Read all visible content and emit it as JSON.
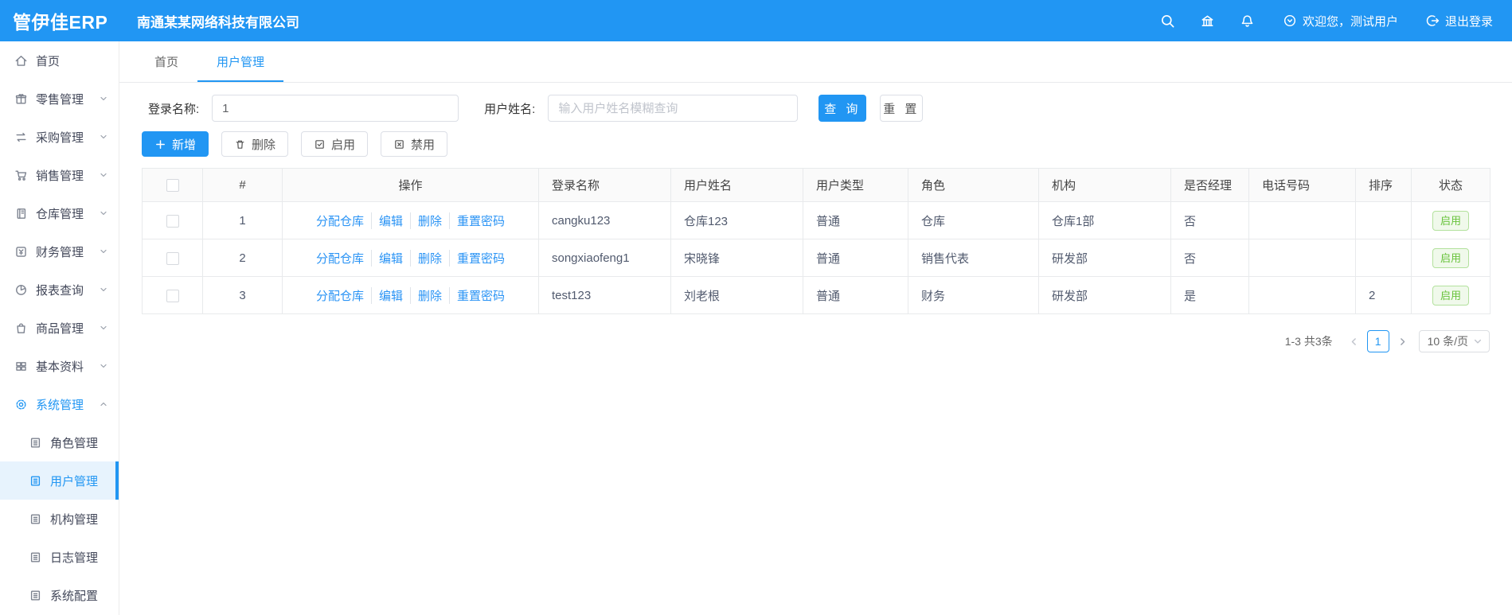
{
  "header": {
    "logo": "管伊佳ERP",
    "company": "南通某某网络科技有限公司",
    "welcome": "欢迎您，测试用户",
    "logout": "退出登录"
  },
  "sidebar": {
    "items": [
      {
        "label": "首页",
        "icon": "home-icon"
      },
      {
        "label": "零售管理",
        "icon": "retail-icon"
      },
      {
        "label": "采购管理",
        "icon": "purchase-icon"
      },
      {
        "label": "销售管理",
        "icon": "sales-cart-icon"
      },
      {
        "label": "仓库管理",
        "icon": "warehouse-icon"
      },
      {
        "label": "财务管理",
        "icon": "finance-icon"
      },
      {
        "label": "报表查询",
        "icon": "report-pie-icon"
      },
      {
        "label": "商品管理",
        "icon": "goods-bag-icon"
      },
      {
        "label": "基本资料",
        "icon": "basedata-grid-icon"
      },
      {
        "label": "系统管理",
        "icon": "system-gear-icon",
        "expanded": true
      }
    ],
    "submenu": [
      {
        "label": "角色管理",
        "active": false
      },
      {
        "label": "用户管理",
        "active": true
      },
      {
        "label": "机构管理",
        "active": false
      },
      {
        "label": "日志管理",
        "active": false
      },
      {
        "label": "系统配置",
        "active": false
      }
    ]
  },
  "tabs": {
    "0": "首页",
    "1": "用户管理",
    "active_index": 1
  },
  "filters": {
    "login_name_label": "登录名称:",
    "login_name_value": "1",
    "user_name_label": "用户姓名:",
    "user_name_placeholder": "输入用户姓名模糊查询",
    "search_label": "查 询",
    "reset_label": "重 置"
  },
  "toolbar": {
    "add_label": "新增",
    "delete_label": "删除",
    "enable_label": "启用",
    "disable_label": "禁用"
  },
  "table": {
    "headers": [
      "",
      "#",
      "操作",
      "登录名称",
      "用户姓名",
      "用户类型",
      "角色",
      "机构",
      "是否经理",
      "电话号码",
      "排序",
      "状态"
    ],
    "action_links": [
      "分配仓库",
      "编辑",
      "删除",
      "重置密码"
    ],
    "rows": [
      {
        "index": "1",
        "login": "cangku123",
        "name": "仓库123",
        "type": "普通",
        "role": "仓库",
        "org": "仓库1部",
        "manager": "否",
        "phone": "",
        "sort": "",
        "status": "启用"
      },
      {
        "index": "2",
        "login": "songxiaofeng1",
        "name": "宋晓锋",
        "type": "普通",
        "role": "销售代表",
        "org": "研发部",
        "manager": "否",
        "phone": "",
        "sort": "",
        "status": "启用"
      },
      {
        "index": "3",
        "login": "test123",
        "name": "刘老根",
        "type": "普通",
        "role": "财务",
        "org": "研发部",
        "manager": "是",
        "phone": "",
        "sort": "2",
        "status": "启用"
      }
    ]
  },
  "pagination": {
    "summary": "1-3 共3条",
    "page": "1",
    "page_size": "10 条/页"
  },
  "colors": {
    "primary": "#2196f3",
    "badge_green_text": "#67c23a",
    "badge_green_border": "#b3e19d",
    "badge_green_bg": "#f0f9eb",
    "header_bg": "#2196f3",
    "table_border": "#e8eaec"
  }
}
